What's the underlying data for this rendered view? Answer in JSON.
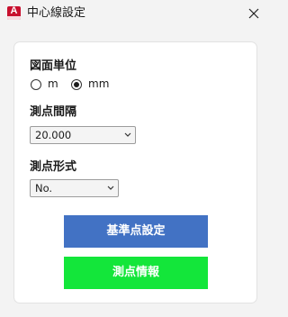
{
  "window": {
    "title": "中心線設定",
    "app_icon_letter": "A"
  },
  "drawing_units": {
    "label": "図面単位",
    "options": [
      {
        "label": "m",
        "selected": false
      },
      {
        "label": "mm",
        "selected": true
      }
    ]
  },
  "station_interval": {
    "label": "測点間隔",
    "value": "20.000"
  },
  "station_format": {
    "label": "測点形式",
    "value": "No."
  },
  "buttons": {
    "reference_point": "基準点設定",
    "station_info": "測点情報"
  },
  "colors": {
    "reference_button": "#4272c4",
    "info_button": "#13e63a",
    "app_icon": "#c8102e"
  }
}
